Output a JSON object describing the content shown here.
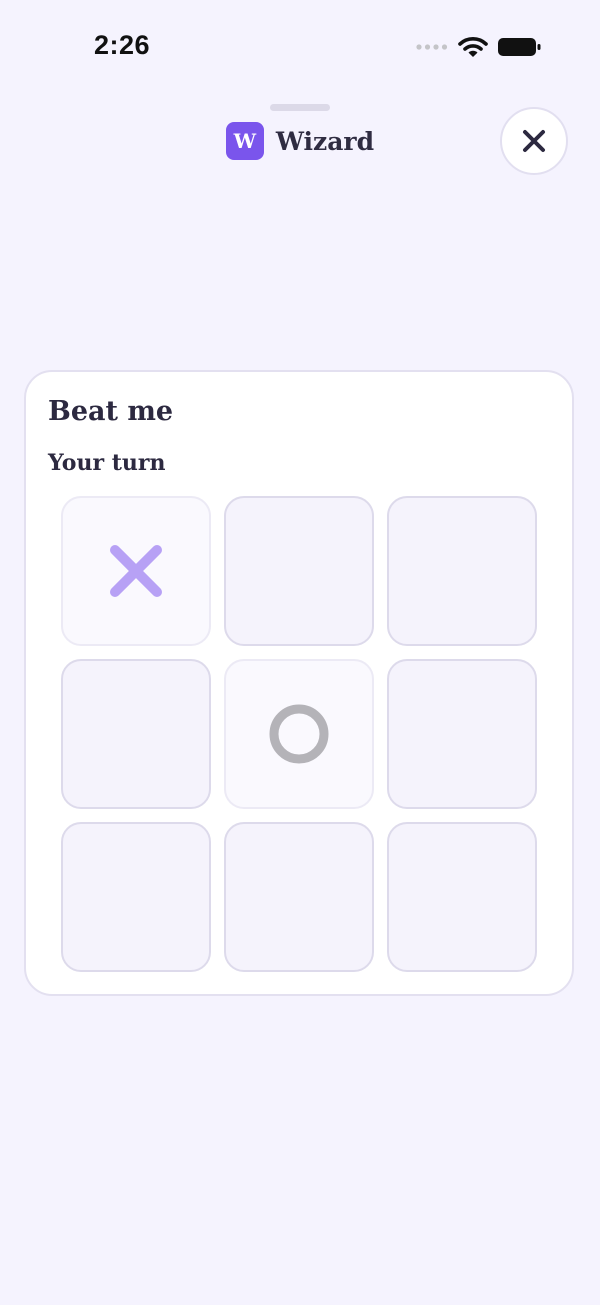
{
  "status_bar": {
    "time": "2:26"
  },
  "header": {
    "logo_letter": "W",
    "app_name": "Wizard",
    "close_icon": "close-icon"
  },
  "game": {
    "title": "Beat me",
    "turn_status": "Your turn",
    "board": [
      [
        "X",
        "",
        ""
      ],
      [
        "",
        "O",
        ""
      ],
      [
        "",
        "",
        ""
      ]
    ]
  },
  "colors": {
    "background": "#f5f3fe",
    "accent": "#7a55ec",
    "x_mark": "#b7a1f5",
    "o_mark": "#b4b3b8",
    "text": "#2c2940"
  }
}
